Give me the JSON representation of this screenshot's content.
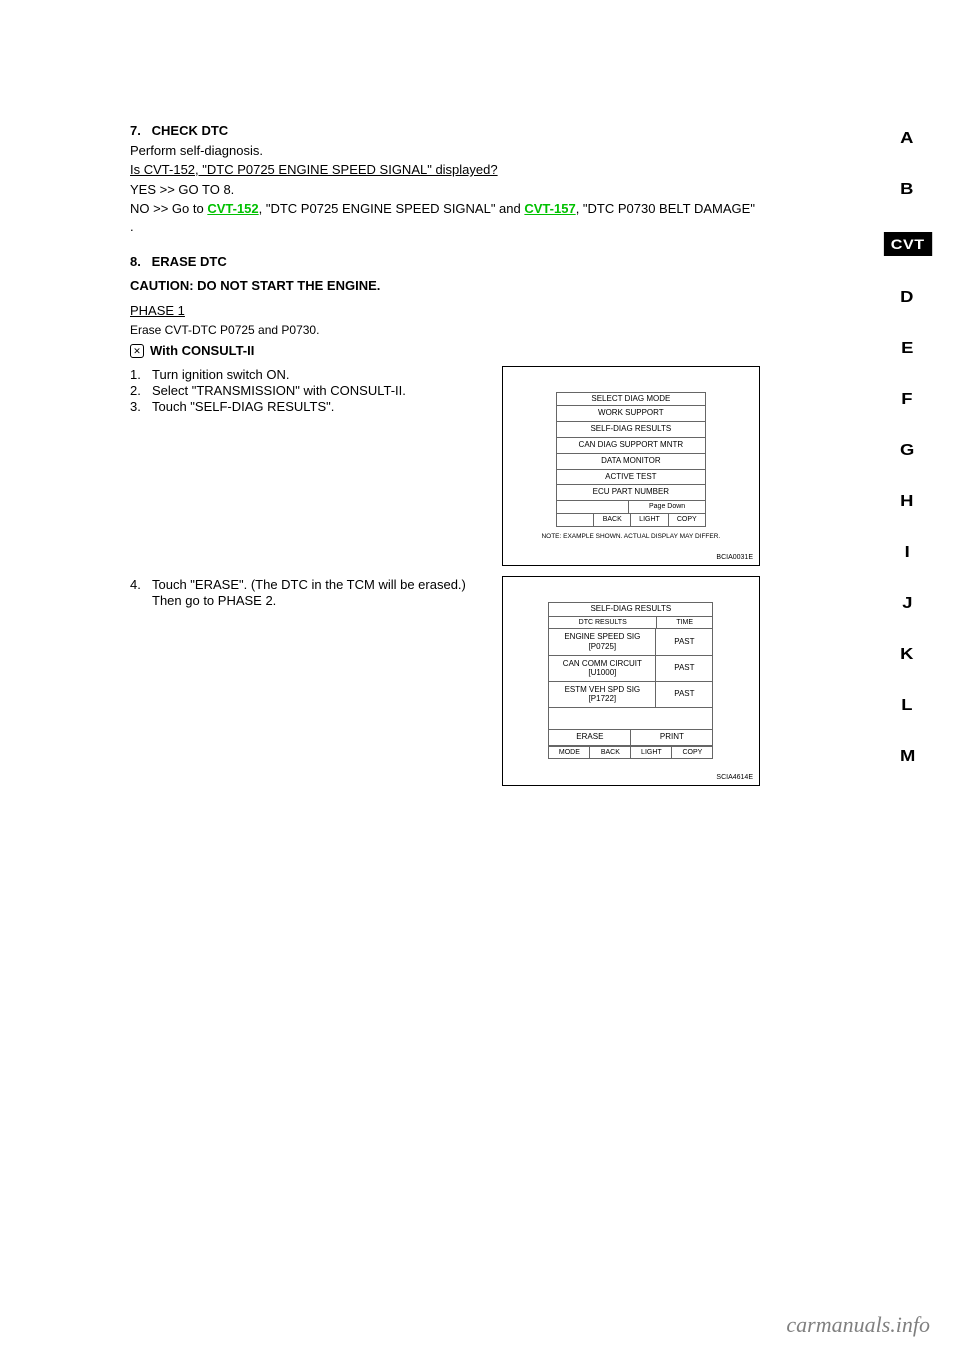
{
  "sidebar": {
    "tabs": [
      "A",
      "B",
      "CVT",
      "D",
      "E",
      "F",
      "G",
      "H",
      "I",
      "J",
      "K",
      "L",
      "M"
    ],
    "active_index": 2
  },
  "step1": {
    "num": "7.",
    "text": "CHECK DTC",
    "body_line1": "Perform self-diagnosis.",
    "q": "Is CVT-152, \"DTC P0725 ENGINE SPEED SIGNAL\" displayed?",
    "yes": "YES >> GO TO 8.",
    "no_prefix": "NO >> Go to ",
    "no_link1": "CVT-152",
    "no_mid": ", \"DTC P0725 ENGINE SPEED SIGNAL\" and ",
    "no_link2": "CVT-157",
    "no_suffix": ", \"DTC P0730 BELT DAMAGE\" ."
  },
  "step2": {
    "num": "8.",
    "text": "ERASE DTC",
    "phase_up": "CAUTION: DO NOT START THE ENGINE.",
    "phase1_header": "PHASE 1",
    "sub1": "Erase CVT-DTC P0725 and P0730.",
    "with": "With CONSULT-II",
    "p1": [
      {
        "n": "1.",
        "t": "Turn ignition switch ON."
      },
      {
        "n": "2.",
        "t": "Select \"TRANSMISSION\" with CONSULT-II."
      },
      {
        "n": "3.",
        "t": "Touch \"SELF-DIAG RESULTS\"."
      }
    ],
    "p1b": [
      {
        "n": "4.",
        "t": "Touch \"ERASE\". (The DTC in the TCM will be erased.)"
      }
    ],
    "goto": "Then go to PHASE 2."
  },
  "figA": {
    "title": "SELECT DIAG MODE",
    "items": [
      "WORK SUPPORT",
      "SELF-DIAG RESULTS",
      "CAN DIAG SUPPORT MNTR",
      "DATA MONITOR",
      "ACTIVE TEST",
      "ECU PART NUMBER"
    ],
    "page_down": "Page Down",
    "btns": [
      "",
      "BACK",
      "LIGHT",
      "COPY"
    ],
    "note": "NOTE: EXAMPLE SHOWN. ACTUAL DISPLAY MAY DIFFER.",
    "id": "BCIA0031E"
  },
  "figB": {
    "title": "SELF-DIAG RESULTS",
    "col1": "DTC RESULTS",
    "col2": "TIME",
    "rows": [
      {
        "name": "ENGINE SPEED SIG\n[P0725]",
        "time": "PAST"
      },
      {
        "name": "CAN COMM CIRCUIT\n[U1000]",
        "time": "PAST"
      },
      {
        "name": "ESTM VEH SPD SIG\n[P1722]",
        "time": "PAST"
      }
    ],
    "erase": "ERASE",
    "print": "PRINT",
    "btns": [
      "MODE",
      "BACK",
      "LIGHT",
      "COPY"
    ],
    "id": "SCIA4614E"
  },
  "watermark": "carmanuals.info"
}
